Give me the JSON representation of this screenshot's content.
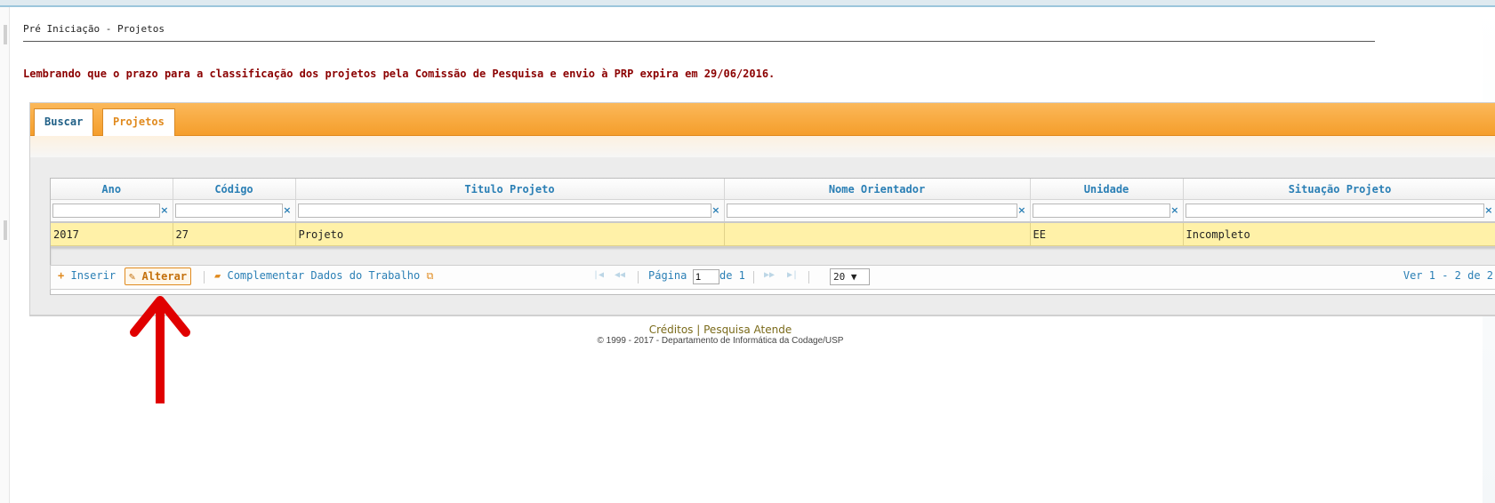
{
  "page": {
    "breadcrumb": "Pré Iniciação - Projetos",
    "notice": "Lembrando que o prazo para a classificação dos projetos pela Comissão de Pesquisa e envio à PRP expira em 29/06/2016."
  },
  "tabs": [
    {
      "label": "Buscar",
      "active": false
    },
    {
      "label": "Projetos",
      "active": true
    }
  ],
  "grid": {
    "columns": [
      "Ano",
      "Código",
      "Titulo Projeto",
      "Nome Orientador",
      "Unidade",
      "Situação Projeto"
    ],
    "rows": [
      {
        "ano": "2017",
        "codigo": "27",
        "titulo": "Projeto",
        "orientador": "",
        "unidade": "EE",
        "situacao": "Incompleto"
      }
    ],
    "clear_symbol": "×"
  },
  "pager": {
    "inserir": "Inserir",
    "alterar": "Alterar",
    "complementar": "Complementar Dados do Trabalho",
    "pagina_label": "Página",
    "pagina_value": "1",
    "de_label": "de 1",
    "page_size": "20 ▼",
    "ver": "Ver 1 - 2 de 2"
  },
  "footer": {
    "creditos": "Créditos",
    "separator": "|",
    "atende": "Pesquisa Atende",
    "copyright": "© 1999 - 2017 - Departamento de Informática da Codage/USP"
  },
  "colors": {
    "accent_orange": "#f59e2b",
    "link_blue": "#2a7fb5",
    "notice_red": "#8b0000",
    "selected_row": "#fff1a8",
    "annotation_arrow": "#e00000"
  }
}
